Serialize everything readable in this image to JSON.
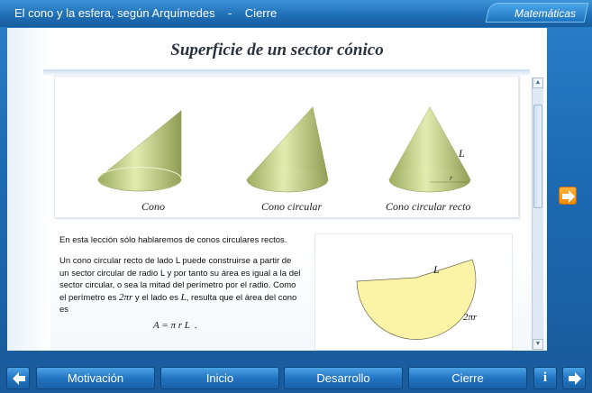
{
  "titlebar": {
    "title": "El cono y la esfera, según Arquímedes    -    Cierre",
    "subject": "Matemáticas"
  },
  "content": {
    "heading": "Superficie de un sector cónico",
    "cones": {
      "labels": [
        "Cono",
        "Cono circular",
        "Cono circular recto"
      ],
      "side_label": "L",
      "radius_label": "r"
    },
    "paragraph1": "En esta lección sólo hablaremos de conos circulares rectos.",
    "paragraph2_a": "Un cono circular recto de lado  L  puede construirse a partir de un sector circular de radio  L  y por tanto su área es igual a la del sector circular, o sea la mitad del perímetro por el radio.  Como el perímetro es ",
    "perimeter": "2πr",
    "paragraph2_b": " y el lado es ",
    "side": "L",
    "paragraph2_c": ", resulta que el área del cono es",
    "formula": "A = π r L  .",
    "sector": {
      "side_label": "L",
      "arc_label": "2πr"
    }
  },
  "nav": {
    "buttons": [
      "Motivación",
      "Inicio",
      "Desarrollo",
      "Cierre"
    ],
    "info_label": "i"
  },
  "colors": {
    "cone_fill": "#c8d48a",
    "sector_fill": "#fbf3a6",
    "accent_orange": "#f08a00",
    "bar_blue": "#1f6fb7"
  }
}
